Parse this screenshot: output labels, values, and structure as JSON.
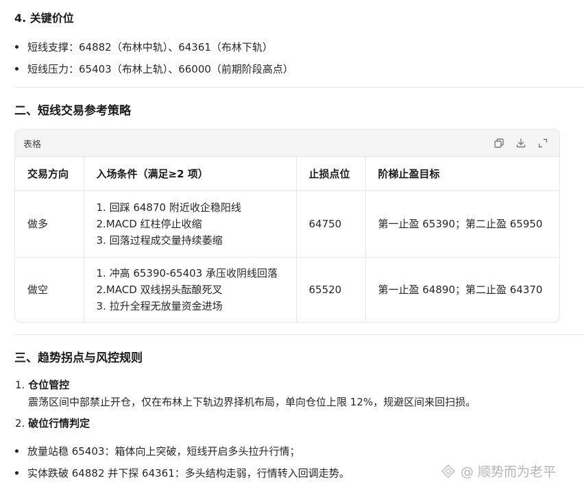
{
  "section4": {
    "title": "4. 关键价位",
    "bullets": [
      "短线支撑：64882（布林中轨）、64361（布林下轨）",
      "短线压力：65403（布林上轨）、66000（前期阶段高点）"
    ]
  },
  "section2": {
    "title": "二、短线交易参考策略",
    "table": {
      "label": "表格",
      "icons": [
        "copy-icon",
        "download-icon",
        "expand-icon"
      ],
      "headers": [
        "交易方向",
        "入场条件（满足≥2 项）",
        "止损点位",
        "阶梯止盈目标"
      ],
      "rows": [
        {
          "direction": "做多",
          "conditions": [
            "1. 回踩 64870 附近收企稳阳线",
            "2.MACD 红柱停止收缩",
            "3. 回落过程成交量持续萎缩"
          ],
          "stop": "64750",
          "target": "第一止盈 65390；第二止盈 65950"
        },
        {
          "direction": "做空",
          "conditions": [
            "1. 冲高 65390-65403 承压收阴线回落",
            "2.MACD 双线拐头酝酿死叉",
            "3. 拉升全程无放量资金进场"
          ],
          "stop": "65520",
          "target": "第一止盈 64890；第二止盈 64370"
        }
      ]
    }
  },
  "section3": {
    "title": "三、趋势拐点与风控规则",
    "items": [
      {
        "num": "1.",
        "title": "仓位管控",
        "text": "震荡区间中部禁止开仓，仅在布林上下轨边界择机布局，单向仓位上限 12%，规避区间来回扫损。"
      },
      {
        "num": "2.",
        "title": "破位行情判定"
      }
    ],
    "bullets": [
      "放量站稳 65403：箱体向上突破，短线开启多头拉升行情；",
      "实体跌破 64882 并下探 64361：多头结构走弱，行情转入回调走势。"
    ]
  },
  "watermark": {
    "text": "@ 顺势而为老平"
  }
}
